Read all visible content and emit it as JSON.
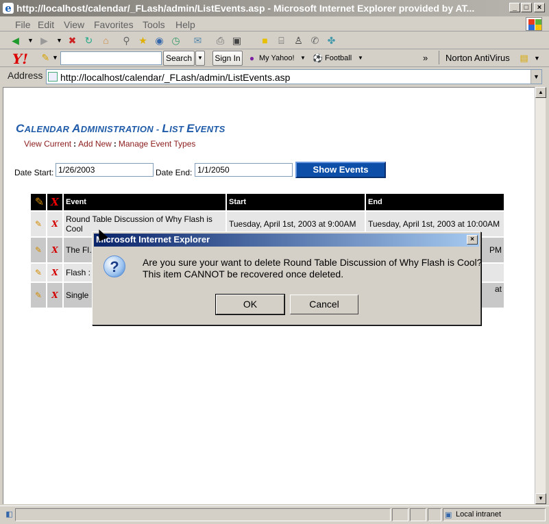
{
  "window": {
    "title": "http://localhost/calendar/_FLash/admin/ListEvents.asp - Microsoft Internet Explorer provided by AT...",
    "minimize_icon": "minimize-icon",
    "maximize_icon": "maximize-icon",
    "close_icon": "close-icon"
  },
  "menu": {
    "items": [
      "File",
      "Edit",
      "View",
      "Favorites",
      "Tools",
      "Help"
    ]
  },
  "yahoo_toolbar": {
    "search_label": "Search",
    "signin_label": "Sign In",
    "my_yahoo_label": "My Yahoo!",
    "football_label": "Football",
    "more_chevron": "»",
    "norton_label": "Norton AntiVirus"
  },
  "address": {
    "label": "Address",
    "url": "http://localhost/calendar/_FLash/admin/ListEvents.asp"
  },
  "page": {
    "heading_parts": [
      {
        "cap": "C",
        "rest": "ALENDAR "
      },
      {
        "cap": "A",
        "rest": "DMINISTRATION - "
      },
      {
        "cap": "L",
        "rest": "IST "
      },
      {
        "cap": "E",
        "rest": "VENTS"
      }
    ],
    "nav": {
      "view_current": "View Current",
      "add_new": "Add New",
      "manage_types": "Manage Event Types",
      "separator": ":"
    },
    "date_start_label": "Date Start:",
    "date_start_value": "1/26/2003",
    "date_end_label": "Date End:",
    "date_end_value": "1/1/2050",
    "show_button": "Show Events"
  },
  "table": {
    "headers": [
      "Event",
      "Start",
      "End"
    ],
    "rows": [
      {
        "event": "Round Table Discussion of Why Flash is Cool",
        "start": "Tuesday, April 1st, 2003 at 9:00AM",
        "end": "Tuesday, April 1st, 2003 at 10:00AM"
      },
      {
        "event": "The Fl… Group",
        "start": "",
        "end": "PM"
      },
      {
        "event": "Flash :",
        "start": "",
        "end": ""
      },
      {
        "event": "Single",
        "start": "",
        "end": "at"
      }
    ]
  },
  "dialog": {
    "title": "Microsoft Internet Explorer",
    "line1": "Are you sure your want to delete Round Table Discussion of Why Flash is Cool?",
    "line2": "This item CANNOT be recovered once deleted.",
    "ok": "OK",
    "cancel": "Cancel"
  },
  "status": {
    "zone": "Local intranet"
  }
}
